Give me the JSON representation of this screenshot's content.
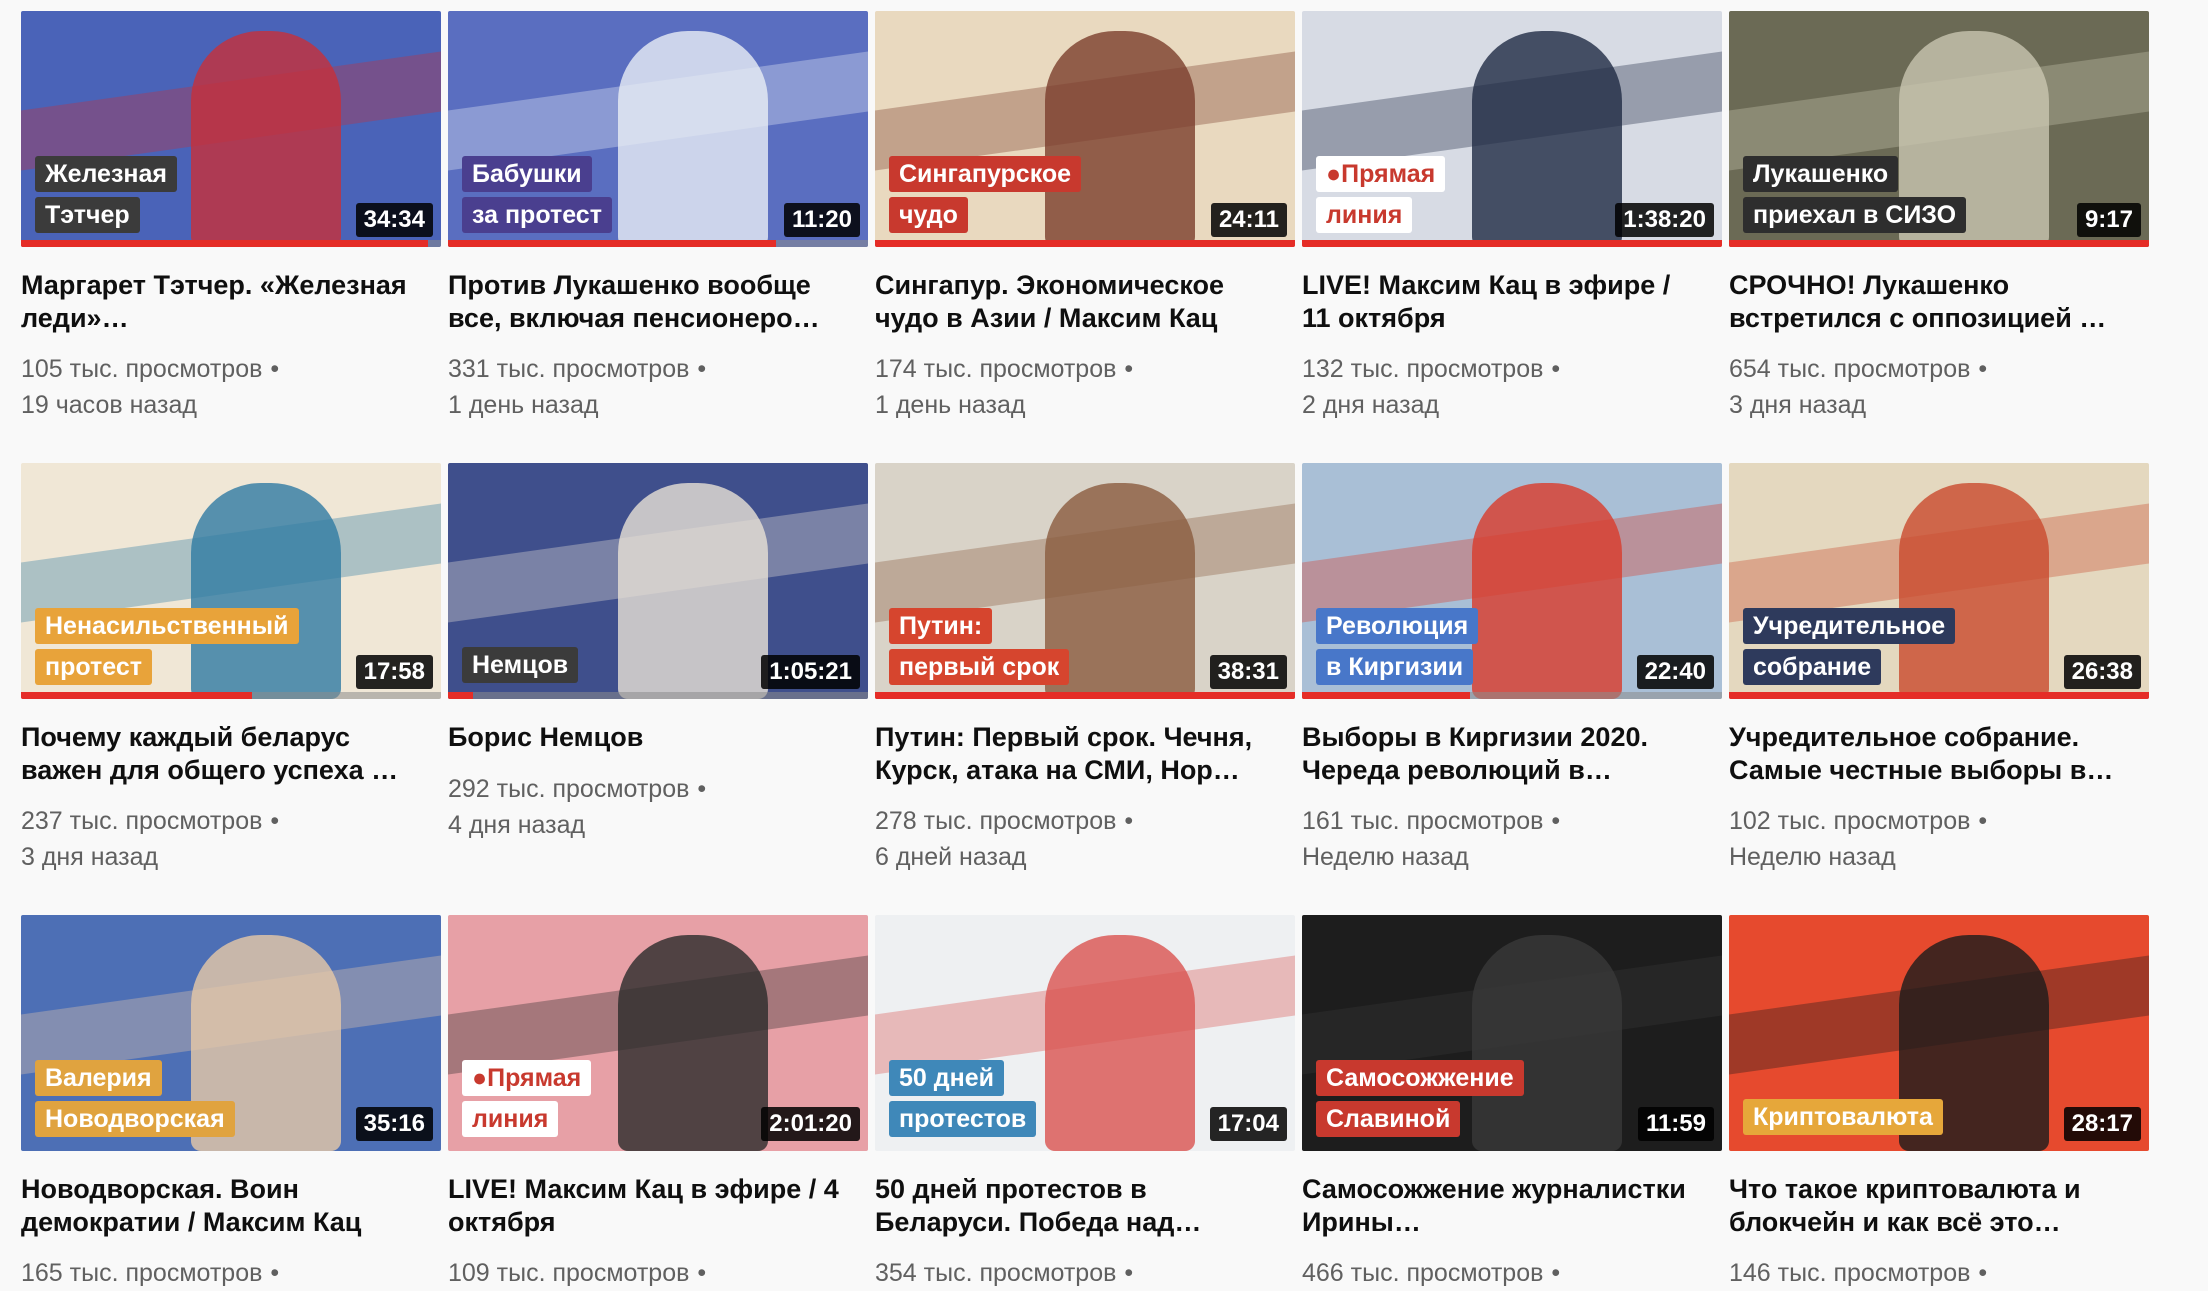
{
  "videos": [
    {
      "title": "Маргарет Тэтчер. «Железная леди»…",
      "views": "105 тыс. просмотров",
      "age": "19 часов назад",
      "duration": "34:34",
      "overlay": [
        "Железная",
        "Тэтчер"
      ],
      "overlay_color": "#3b3b3b",
      "thumb_bg": "#4a63b8",
      "thumb_fg": "#c7303a",
      "progress": 0.97
    },
    {
      "title": "Против Лукашенко вообще все, включая пенсионеро…",
      "views": "331 тыс. просмотров",
      "age": "1 день назад",
      "duration": "11:20",
      "overlay": [
        "Бабушки",
        "за протест"
      ],
      "overlay_color": "#4a3f8f",
      "thumb_bg": "#5a6ec0",
      "thumb_fg": "#e9eef5",
      "progress": 0.78
    },
    {
      "title": "Сингапур. Экономическое чудо в Азии / Максим Кац",
      "views": "174 тыс. просмотров",
      "age": "1 день назад",
      "duration": "24:11",
      "overlay": [
        "Сингапурское",
        "чудо"
      ],
      "overlay_color": "#c8392e",
      "thumb_bg": "#e9d9bf",
      "thumb_fg": "#7a3d2c",
      "progress": 1.0
    },
    {
      "title": "LIVE! Максим Кац в эфире / 11 октября",
      "views": "132 тыс. просмотров",
      "age": "2 дня назад",
      "duration": "1:38:20",
      "overlay": [
        "●Прямая",
        "линия"
      ],
      "overlay_color": "#ffffff",
      "overlay_text": "#c8392e",
      "thumb_bg": "#d7dbe4",
      "thumb_fg": "#1f2a44",
      "progress": 1.0
    },
    {
      "title": "СРОЧНО! Лукашенко встретился с оппозицией …",
      "views": "654 тыс. просмотров",
      "age": "3 дня назад",
      "duration": "9:17",
      "overlay": [
        "Лукашенко",
        "приехал в СИЗО"
      ],
      "overlay_color": "#2e2e2e",
      "thumb_bg": "#6b6a55",
      "thumb_fg": "#c9c6b0",
      "progress": 1.0
    },
    {
      "title": "Почему каждый беларус важен для общего успеха …",
      "views": "237 тыс. просмотров",
      "age": "3 дня назад",
      "duration": "17:58",
      "overlay": [
        "Ненасильственный",
        "протест"
      ],
      "overlay_color": "#e8a33a",
      "thumb_bg": "#f0e7d6",
      "thumb_fg": "#2f7aa3",
      "progress": 0.55
    },
    {
      "title": "Борис Немцов",
      "views": "292 тыс. просмотров",
      "age": "4 дня назад",
      "duration": "1:05:21",
      "overlay": [
        "Немцов"
      ],
      "overlay_color": "#3b3b3b",
      "thumb_bg": "#3f4f8c",
      "thumb_fg": "#e8e1d6",
      "progress": 0.06
    },
    {
      "title": "Путин: Первый срок. Чечня, Курск, атака на СМИ, Нор…",
      "views": "278 тыс. просмотров",
      "age": "6 дней назад",
      "duration": "38:31",
      "overlay": [
        "Путин:",
        "первый срок"
      ],
      "overlay_color": "#d6452e",
      "thumb_bg": "#d9d3c8",
      "thumb_fg": "#8a5b3f",
      "progress": 1.0
    },
    {
      "title": "Выборы в Киргизии 2020. Череда революций в…",
      "views": "161 тыс. просмотров",
      "age": "Неделю назад",
      "duration": "22:40",
      "overlay": [
        "Революция",
        "в Киргизии"
      ],
      "overlay_color": "#4877c9",
      "thumb_bg": "#a9bfd6",
      "thumb_fg": "#d93b2b",
      "progress": 0.4
    },
    {
      "title": "Учредительное собрание. Самые честные выборы в…",
      "views": "102 тыс. просмотров",
      "age": "Неделю назад",
      "duration": "26:38",
      "overlay": [
        "Учредительное",
        "собрание"
      ],
      "overlay_color": "#2e3a5c",
      "thumb_bg": "#e4d8bf",
      "thumb_fg": "#c94a2d",
      "progress": 1.0
    },
    {
      "title": "Новодворская. Воин демократии / Максим Кац",
      "views": "165 тыс. просмотров",
      "age": "",
      "duration": "35:16",
      "overlay": [
        "Валерия",
        "Новодворская"
      ],
      "overlay_color": "#e0a33f",
      "thumb_bg": "#4d6fb5",
      "thumb_fg": "#e7c9a8",
      "progress": 0.0
    },
    {
      "title": "LIVE! Максим Кац в эфире / 4 октября",
      "views": "109 тыс. просмотров",
      "age": "",
      "duration": "2:01:20",
      "overlay": [
        "●Прямая",
        "линия"
      ],
      "overlay_color": "#ffffff",
      "overlay_text": "#c8392e",
      "thumb_bg": "#e7a0a6",
      "thumb_fg": "#2a2a2a",
      "progress": 0.0
    },
    {
      "title": "50 дней протестов в Беларуси. Победа над…",
      "views": "354 тыс. просмотров",
      "age": "",
      "duration": "17:04",
      "overlay": [
        "50 дней",
        "протестов"
      ],
      "overlay_color": "#3f88b9",
      "thumb_bg": "#eef0f2",
      "thumb_fg": "#d9534f",
      "progress": 0.0
    },
    {
      "title": "Самосожжение журналистки Ирины…",
      "views": "466 тыс. просмотров",
      "age": "",
      "duration": "11:59",
      "overlay": [
        "Самосожжение",
        "Славиной"
      ],
      "overlay_color": "#c8392e",
      "thumb_bg": "#1d1d1d",
      "thumb_fg": "#3a3a3a",
      "progress": 0.0
    },
    {
      "title": "Что такое криптовалюта и блокчейн и как всё это…",
      "views": "146 тыс. просмотров",
      "age": "",
      "duration": "28:17",
      "overlay": [
        "Криптовалюта"
      ],
      "overlay_color": "#e6a73a",
      "thumb_bg": "#e64a2e",
      "thumb_fg": "#1b1b1b",
      "progress": 0.0
    }
  ],
  "separator": "•"
}
